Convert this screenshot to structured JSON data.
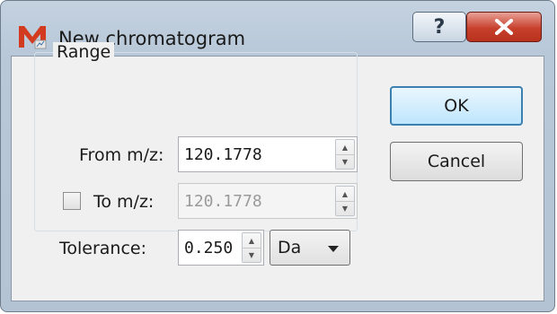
{
  "window": {
    "title": "New chromatogram",
    "help_label": "?",
    "icons": {
      "app": "app-logo-icon",
      "help": "help-icon",
      "close": "close-icon"
    }
  },
  "range_group": {
    "title": "Range",
    "from": {
      "label": "From m/z:",
      "value": "120.1778"
    },
    "to": {
      "label": "To m/z:",
      "value": "120.1778",
      "checked": false,
      "enabled": false
    },
    "tolerance": {
      "label": "Tolerance:",
      "value": "0.250",
      "unit": "Da"
    }
  },
  "buttons": {
    "ok": "OK",
    "cancel": "Cancel"
  },
  "colors": {
    "title_bar": "#b8c8d8",
    "close_button": "#c7402c",
    "default_button_border": "#3c7fb1"
  }
}
